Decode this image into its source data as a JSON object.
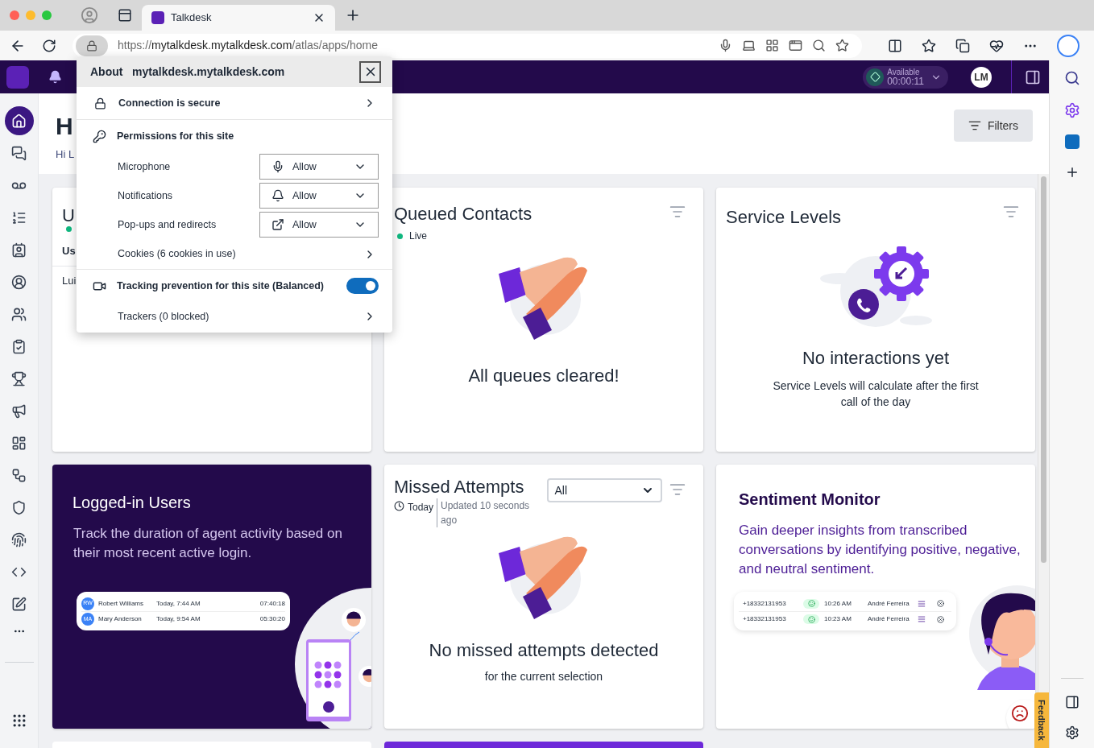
{
  "browser": {
    "tabs": [
      {
        "title": "Talkdesk",
        "selected": true
      }
    ],
    "url": {
      "scheme": "https://",
      "host": "mytalkdesk.mytalkdesk.com",
      "path": "/atlas/apps/home"
    }
  },
  "app_header": {
    "status": "Available",
    "timer": "00:00:11",
    "avatar": "LM"
  },
  "nav": {
    "items": [
      {
        "selected": true
      },
      {
        "selected": false
      },
      {
        "selected": false
      },
      {
        "selected": false
      },
      {
        "selected": false
      },
      {
        "selected": false
      },
      {
        "selected": false
      },
      {
        "selected": false
      },
      {
        "selected": false
      },
      {
        "selected": false
      },
      {
        "selected": false
      },
      {
        "selected": false
      },
      {
        "selected": false
      },
      {
        "selected": false
      },
      {
        "selected": false
      },
      {
        "selected": false
      }
    ]
  },
  "page": {
    "title": "H",
    "greeting": "Hi L",
    "filters": "Filters"
  },
  "popup": {
    "about": "About",
    "host": "mytalkdesk.mytalkdesk.com",
    "connection": "Connection is secure",
    "permissions_heading": "Permissions for this site",
    "permissions": [
      {
        "kind": "microphone",
        "label": "Microphone",
        "value": "Allow"
      },
      {
        "kind": "notifications",
        "label": "Notifications",
        "value": "Allow"
      },
      {
        "kind": "popups",
        "label": "Pop-ups and redirects",
        "value": "Allow"
      }
    ],
    "cookies": "Cookies (6 cookies in use)",
    "tracking": {
      "label": "Tracking prevention for this site (Balanced)",
      "on": true
    },
    "trackers": "Trackers (0 blocked)"
  },
  "cards": {
    "users": {
      "title": "U",
      "column": "Us",
      "cell": "Lui"
    },
    "queued": {
      "title": "Queued Contacts",
      "status": "Live",
      "message": "All queues cleared!"
    },
    "service": {
      "title": "Service Levels",
      "message": "No interactions yet",
      "detail": "Service Levels will calculate after the first call of the day"
    },
    "logged_in": {
      "title": "Logged-in Users",
      "text": "Track the duration of agent activity based on their most recent active login.",
      "rows": [
        {
          "initials": "RW",
          "name": "Robert Williams",
          "time": "Today, 7:44 AM",
          "duration": "07:40:18"
        },
        {
          "initials": "MA",
          "name": "Mary Anderson",
          "time": "Today, 9:54 AM",
          "duration": "05:30:20"
        }
      ]
    },
    "missed": {
      "title": "Missed Attempts",
      "select": "All",
      "period": "Today",
      "updated": "Updated 10 seconds ago",
      "message": "No missed attempts detected",
      "detail": "for the current selection"
    },
    "sentiment": {
      "title": "Sentiment Monitor",
      "text": "Gain deeper insights from transcribed conversations by identifying positive, negative, and neutral sentiment.",
      "rows": [
        {
          "phone": "+18332131953",
          "time": "10:26 AM",
          "agent": "André Ferreira"
        },
        {
          "phone": "+18332131953",
          "time": "10:23 AM",
          "agent": "André Ferreira"
        }
      ]
    }
  },
  "feedback": "Feedback"
}
